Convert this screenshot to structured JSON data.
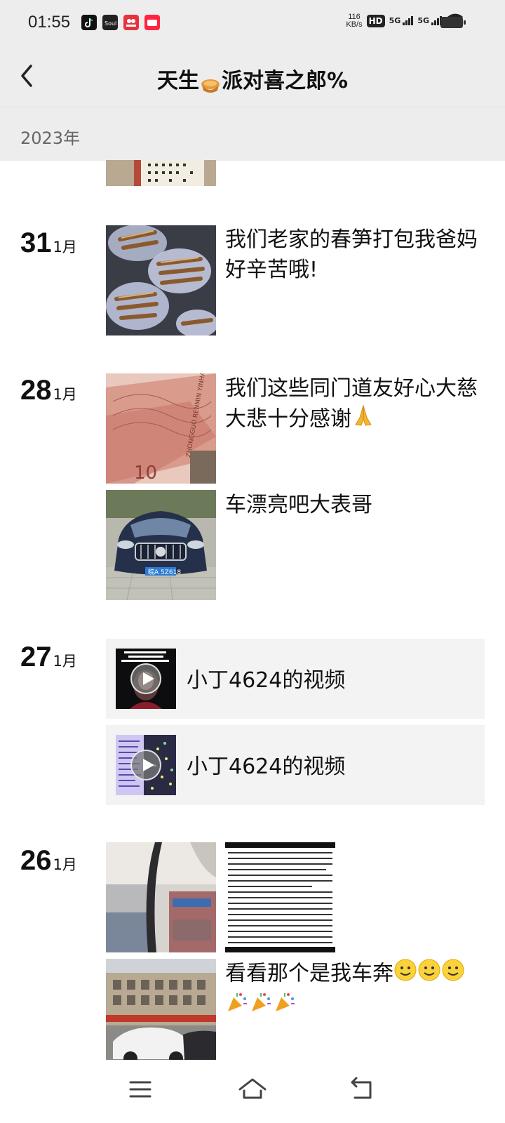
{
  "status_bar": {
    "time": "01:55",
    "net_speed_value": "116",
    "net_speed_unit": "KB/s",
    "hd_label": "HD",
    "hd_sub": "1\n2",
    "sim1": "5G",
    "sim2": "5G",
    "app_icons": [
      "tiktok-icon",
      "soul-icon",
      "shopping-app-icon",
      "red-app-icon"
    ]
  },
  "nav": {
    "title_left": "天生",
    "title_right": "派对喜之郎%",
    "title_emoji": "pie-emoji"
  },
  "year_header": "2023年",
  "posts": [
    {
      "day": "31",
      "month": "1月",
      "caption": "我们老家的春笋打包我爸妈好辛苦哦!"
    },
    {
      "day": "28",
      "month": "1月",
      "caption": "我们这些同门道友好心大慈大悲十分感谢",
      "caption_emoji": "folded-hands-emoji",
      "second_caption": "车漂亮吧大表哥",
      "plate_text": "皖A 5Z618"
    },
    {
      "day": "27",
      "month": "1月",
      "videos": [
        {
          "title": "小丁4624的视频"
        },
        {
          "title": "小丁4624的视频"
        }
      ]
    },
    {
      "day": "26",
      "month": "1月",
      "caption": "看看那个是我车奔",
      "caption_emojis": [
        "smiley-emoji",
        "smiley-emoji",
        "smiley-emoji",
        "party-popper-emoji",
        "party-popper-emoji",
        "party-popper-emoji"
      ]
    }
  ],
  "colors": {
    "header_bg": "#ededed",
    "video_card_bg": "#f3f3f3"
  }
}
